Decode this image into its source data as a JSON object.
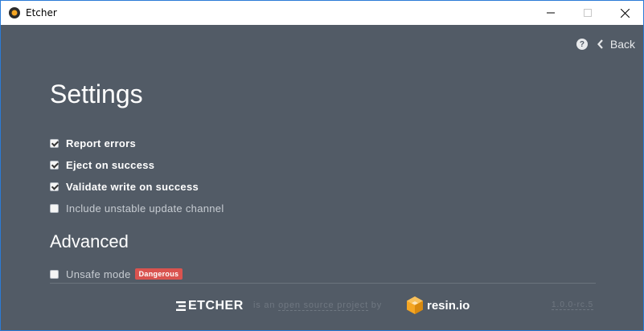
{
  "window": {
    "title": "Etcher",
    "controls": {
      "minimize": "minimize",
      "maximize": "maximize",
      "close": "close"
    }
  },
  "nav": {
    "help_icon": "?",
    "back_label": "Back"
  },
  "settings": {
    "title": "Settings",
    "options": [
      {
        "label": "Report errors",
        "checked": true
      },
      {
        "label": "Eject on success",
        "checked": true
      },
      {
        "label": "Validate write on success",
        "checked": true
      },
      {
        "label": "Include unstable update channel",
        "checked": false
      }
    ]
  },
  "advanced": {
    "title": "Advanced",
    "options": [
      {
        "label": "Unsafe mode",
        "checked": false,
        "badge": "Dangerous"
      }
    ]
  },
  "footer": {
    "brand": "ETCHER",
    "tagline_prefix": "is an",
    "tagline_link": "open source project",
    "tagline_suffix": "by",
    "company": "resin.io",
    "version": "1.0.0-rc.5"
  },
  "colors": {
    "background": "#525b66",
    "danger": "#d9534f",
    "resin_orange": "#f5a623"
  }
}
